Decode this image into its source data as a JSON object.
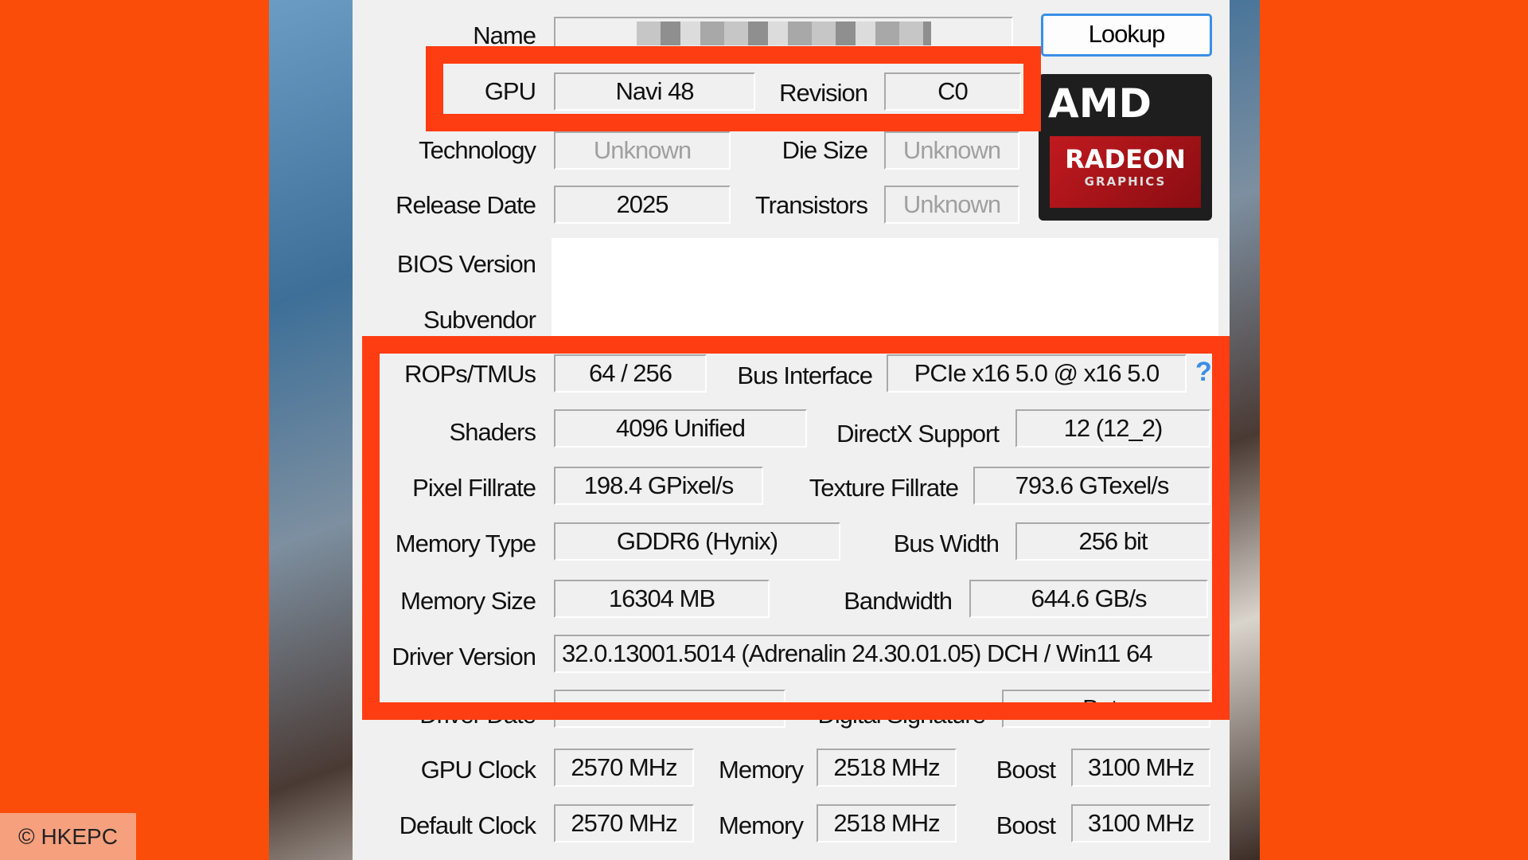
{
  "colors": {
    "background": "#fa4d0a",
    "highlight_box": "#ff3d12",
    "link": "#3a8ee6"
  },
  "fields": {
    "name": {
      "label": "Name",
      "value": ""
    },
    "lookup": "Lookup",
    "gpu": {
      "label": "GPU",
      "value": "Navi 48"
    },
    "revision": {
      "label": "Revision",
      "value": "C0"
    },
    "technology": {
      "label": "Technology",
      "value": "Unknown"
    },
    "die_size": {
      "label": "Die Size",
      "value": "Unknown"
    },
    "release_date": {
      "label": "Release Date",
      "value": "2025"
    },
    "transistors": {
      "label": "Transistors",
      "value": "Unknown"
    },
    "bios_version": {
      "label": "BIOS Version",
      "value": ""
    },
    "subvendor": {
      "label": "Subvendor",
      "value": ""
    },
    "rops_tmus": {
      "label": "ROPs/TMUs",
      "value": "64 / 256"
    },
    "bus_interface": {
      "label": "Bus Interface",
      "value": "PCIe x16 5.0 @ x16 5.0",
      "help": "?"
    },
    "shaders": {
      "label": "Shaders",
      "value": "4096 Unified"
    },
    "directx": {
      "label": "DirectX Support",
      "value": "12 (12_2)"
    },
    "pixel_fillrate": {
      "label": "Pixel Fillrate",
      "value": "198.4 GPixel/s"
    },
    "texture_fillrate": {
      "label": "Texture Fillrate",
      "value": "793.6 GTexel/s"
    },
    "memory_type": {
      "label": "Memory Type",
      "value": "GDDR6 (Hynix)"
    },
    "bus_width": {
      "label": "Bus Width",
      "value": "256 bit"
    },
    "memory_size": {
      "label": "Memory Size",
      "value": "16304 MB"
    },
    "bandwidth": {
      "label": "Bandwidth",
      "value": "644.6 GB/s"
    },
    "driver_version": {
      "label": "Driver Version",
      "value": "32.0.13001.5014 (Adrenalin 24.30.01.05) DCH / Win11 64"
    },
    "driver_date": {
      "label": "Driver Date",
      "value": ""
    },
    "digital_signature": {
      "label": "Digital Signature",
      "value": "Beta"
    },
    "gpu_clock": {
      "label": "GPU Clock",
      "value": "2570 MHz",
      "memory_label": "Memory",
      "memory": "2518 MHz",
      "boost_label": "Boost",
      "boost": "3100 MHz"
    },
    "default_clock": {
      "label": "Default Clock",
      "value": "2570 MHz",
      "memory_label": "Memory",
      "memory": "2518 MHz",
      "boost_label": "Boost",
      "boost": "3100 MHz"
    }
  },
  "logo": {
    "brand": "AMD",
    "product": "RADEON",
    "sub": "GRAPHICS"
  },
  "watermark": "© HKEPC"
}
